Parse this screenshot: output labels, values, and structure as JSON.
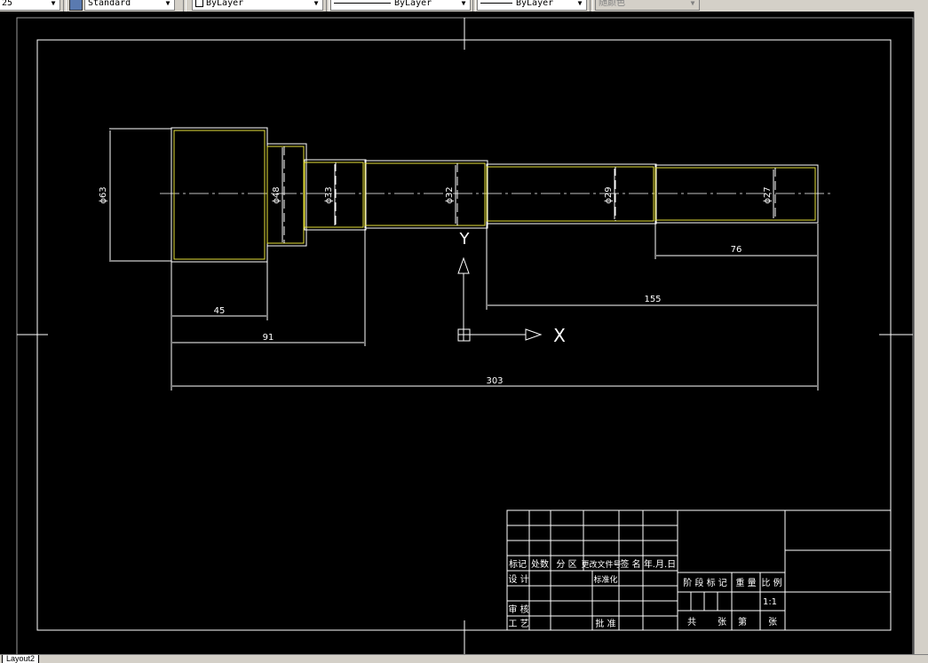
{
  "toolbar": {
    "textstyle_prefix": "25",
    "textstyle": "Standard",
    "layer": "ByLayer",
    "linetype": "ByLayer",
    "lineweight": "ByLayer",
    "plotstyle": "随颜色"
  },
  "drawing": {
    "diameters": [
      "ϕ63",
      "ϕ48",
      "ϕ33",
      "ϕ32",
      "ϕ29",
      "ϕ27"
    ],
    "dims": {
      "d45": "45",
      "d91": "91",
      "d303": "303",
      "d155": "155",
      "d76": "76"
    },
    "ucs": {
      "y": "Y",
      "x": "X"
    }
  },
  "title_block": {
    "mark": "标记",
    "count": "处数",
    "zone": "分 区",
    "change_doc": "更改文件号",
    "sign": "签 名",
    "date": "年.月.日",
    "design": "设 计",
    "standardize": "标准化",
    "stage_mark": "阶 段 标 记",
    "weight": "重 量",
    "scale": "比 例",
    "scale_value": "1:1",
    "review": "审 核",
    "process": "工 艺",
    "approve": "批 准",
    "total": "共",
    "sheets1": "张",
    "nth": "第",
    "sheets2": "张"
  },
  "status": {
    "layout_tab": "Layout2"
  }
}
